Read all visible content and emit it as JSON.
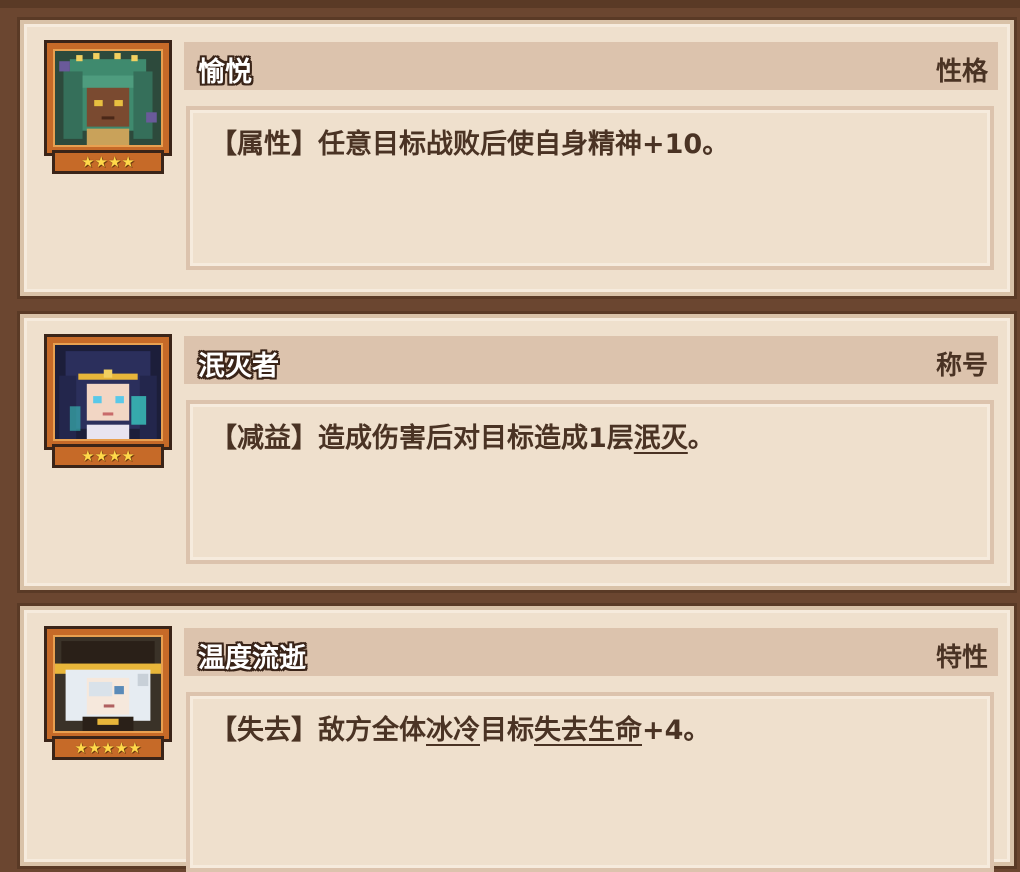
{
  "cards": [
    {
      "title": "愉悦",
      "tag": "性格",
      "stars": "★★★★",
      "desc_prefix": "【属性】任意目标战败后使自身精神+10。",
      "colors": {
        "hair": "#3f8a6e",
        "skin": "#7a4a30"
      }
    },
    {
      "title": "泯灭者",
      "tag": "称号",
      "stars": "★★★★",
      "desc_prefix": "【减益】造成伤害后对目标造成1层",
      "kw1": "泯灭",
      "desc_suffix": "。",
      "colors": {
        "hair": "#2b2f5c",
        "skin": "#f2d6c4"
      }
    },
    {
      "title": "温度流逝",
      "tag": "特性",
      "stars": "★★★★★",
      "desc_prefix": "【失去】敌方全体",
      "kw1": "冰冷",
      "desc_mid": "目标",
      "kw2": "失去生命",
      "desc_suffix": "+4。",
      "colors": {
        "hair": "#e6ecf2",
        "hat": "#2a2018",
        "band": "#e8b63a"
      }
    }
  ]
}
